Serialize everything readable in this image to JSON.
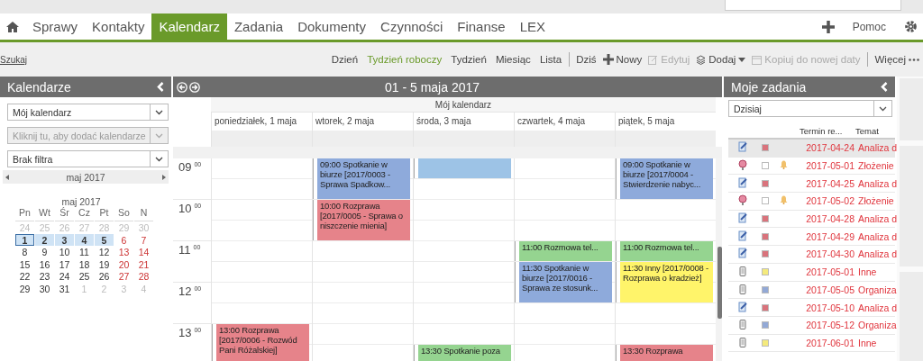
{
  "nav": {
    "tabs": [
      {
        "label": "Sprawy",
        "selected": false
      },
      {
        "label": "Kontakty",
        "selected": false
      },
      {
        "label": "Kalendarz",
        "selected": true
      },
      {
        "label": "Zadania",
        "selected": false
      },
      {
        "label": "Dokumenty",
        "selected": false
      },
      {
        "label": "Czynności",
        "selected": false
      },
      {
        "label": "Finanse",
        "selected": false
      },
      {
        "label": "LEX",
        "selected": false
      }
    ],
    "help": "Pomoc"
  },
  "toolbar": {
    "search_link": "Szukaj",
    "views": [
      {
        "label": "Dzień",
        "selected": false
      },
      {
        "label": "Tydzień roboczy",
        "selected": true
      },
      {
        "label": "Tydzień",
        "selected": false
      },
      {
        "label": "Miesiąc",
        "selected": false
      },
      {
        "label": "Lista",
        "selected": false
      }
    ],
    "actions": [
      {
        "kind": "plain",
        "label": "Dziś",
        "disabled": false
      },
      {
        "kind": "new",
        "label": "Nowy",
        "disabled": false
      },
      {
        "kind": "edit",
        "label": "Edytuj",
        "disabled": true
      },
      {
        "kind": "add",
        "label": "Dodaj",
        "disabled": false
      },
      {
        "kind": "copy",
        "label": "Kopiuj do nowej daty",
        "disabled": true
      },
      {
        "kind": "more",
        "label": "Więcej",
        "disabled": false
      }
    ]
  },
  "left_panel": {
    "title": "Kalendarze",
    "selects": [
      {
        "value": "Mój kalendarz",
        "disabled": false
      },
      {
        "value": "Kliknij tu, aby dodać kalendarze",
        "disabled": true
      },
      {
        "value": "Brak filtra",
        "disabled": false
      }
    ],
    "month_nav": "maj 2017",
    "mini_calendar": {
      "title": "maj 2017",
      "weekdays": [
        "Pn",
        "Wt",
        "Śr",
        "Cz",
        "Pt",
        "So",
        "N"
      ],
      "weeks": [
        [
          {
            "d": "24",
            "kind": "other",
            "selected": false,
            "today": false
          },
          {
            "d": "25",
            "kind": "other",
            "selected": false,
            "today": false
          },
          {
            "d": "26",
            "kind": "other",
            "selected": false,
            "today": false
          },
          {
            "d": "27",
            "kind": "other",
            "selected": false,
            "today": false
          },
          {
            "d": "28",
            "kind": "other",
            "selected": false,
            "today": false
          },
          {
            "d": "29",
            "kind": "other",
            "selected": false,
            "today": false
          },
          {
            "d": "30",
            "kind": "other",
            "selected": false,
            "today": false
          }
        ],
        [
          {
            "d": "1",
            "kind": "weekday",
            "selected": true,
            "today": true
          },
          {
            "d": "2",
            "kind": "weekday",
            "selected": true,
            "today": false
          },
          {
            "d": "3",
            "kind": "weekday",
            "selected": true,
            "today": false
          },
          {
            "d": "4",
            "kind": "weekday",
            "selected": true,
            "today": false
          },
          {
            "d": "5",
            "kind": "weekday",
            "selected": true,
            "today": false
          },
          {
            "d": "6",
            "kind": "weekend",
            "selected": false,
            "today": false
          },
          {
            "d": "7",
            "kind": "weekend",
            "selected": false,
            "today": false
          }
        ],
        [
          {
            "d": "8",
            "kind": "weekday",
            "selected": false,
            "today": false
          },
          {
            "d": "9",
            "kind": "weekday",
            "selected": false,
            "today": false
          },
          {
            "d": "10",
            "kind": "weekday",
            "selected": false,
            "today": false
          },
          {
            "d": "11",
            "kind": "weekday",
            "selected": false,
            "today": false
          },
          {
            "d": "12",
            "kind": "weekday",
            "selected": false,
            "today": false
          },
          {
            "d": "13",
            "kind": "weekend",
            "selected": false,
            "today": false
          },
          {
            "d": "14",
            "kind": "weekend",
            "selected": false,
            "today": false
          }
        ],
        [
          {
            "d": "15",
            "kind": "weekday",
            "selected": false,
            "today": false
          },
          {
            "d": "16",
            "kind": "weekday",
            "selected": false,
            "today": false
          },
          {
            "d": "17",
            "kind": "weekday",
            "selected": false,
            "today": false
          },
          {
            "d": "18",
            "kind": "weekday",
            "selected": false,
            "today": false
          },
          {
            "d": "19",
            "kind": "weekday",
            "selected": false,
            "today": false
          },
          {
            "d": "20",
            "kind": "weekend",
            "selected": false,
            "today": false
          },
          {
            "d": "21",
            "kind": "weekend",
            "selected": false,
            "today": false
          }
        ],
        [
          {
            "d": "22",
            "kind": "weekday",
            "selected": false,
            "today": false
          },
          {
            "d": "23",
            "kind": "weekday",
            "selected": false,
            "today": false
          },
          {
            "d": "24",
            "kind": "weekday",
            "selected": false,
            "today": false
          },
          {
            "d": "25",
            "kind": "weekday",
            "selected": false,
            "today": false
          },
          {
            "d": "26",
            "kind": "weekday",
            "selected": false,
            "today": false
          },
          {
            "d": "27",
            "kind": "weekend",
            "selected": false,
            "today": false
          },
          {
            "d": "28",
            "kind": "weekend",
            "selected": false,
            "today": false
          }
        ],
        [
          {
            "d": "29",
            "kind": "weekday",
            "selected": false,
            "today": false
          },
          {
            "d": "30",
            "kind": "weekday",
            "selected": false,
            "today": false
          },
          {
            "d": "31",
            "kind": "weekday",
            "selected": false,
            "today": false
          },
          {
            "d": "1",
            "kind": "other",
            "selected": false,
            "today": false
          },
          {
            "d": "2",
            "kind": "other",
            "selected": false,
            "today": false
          },
          {
            "d": "3",
            "kind": "other",
            "selected": false,
            "today": false
          },
          {
            "d": "4",
            "kind": "other",
            "selected": false,
            "today": false
          }
        ]
      ]
    }
  },
  "calendar": {
    "title": "01 - 5 maja 2017",
    "owner": "Mój kalendarz",
    "hours": [
      {
        "hour": "09",
        "minutes": "00"
      },
      {
        "hour": "10",
        "minutes": "00"
      },
      {
        "hour": "11",
        "minutes": "00"
      },
      {
        "hour": "12",
        "minutes": "00"
      },
      {
        "hour": "13",
        "minutes": "00"
      }
    ],
    "days": [
      {
        "label": "poniedziałek, 1 maja",
        "events": [
          {
            "time": "13:00",
            "kind": "long",
            "color": "#e6838a",
            "title": "Rozprawa [2017/0006 - Rozwód Pani Różalskiej]"
          }
        ]
      },
      {
        "label": "wtorek, 2 maja",
        "events": [
          {
            "time": "09:00",
            "kind": "hour",
            "color": "#8eaadb",
            "title": "Spotkanie w biurze [2017/0003 - Sprawa Spadkow..."
          },
          {
            "time": "10:00",
            "kind": "hour",
            "color": "#e6838a",
            "title": "Rozprawa [2017/0005 - Sprawa o niszczenie mienia]"
          }
        ]
      },
      {
        "label": "środa, 3 maja",
        "events": [
          {
            "kind": "half",
            "color": "#9dc3e6"
          },
          {
            "time": "13:30",
            "kind": "hour",
            "color": "#95d490",
            "title": "Spotkanie poza"
          }
        ]
      },
      {
        "label": "czwartek, 4 maja",
        "events": [
          {
            "time": "11:00",
            "kind": "half",
            "color": "#95d490",
            "title": "Rozmowa tel..."
          },
          {
            "time": "11:30",
            "kind": "hour",
            "color": "#8eaadb",
            "title": "Spotkanie w biurze [2017/0016 - Sprawa ze stosunk..."
          }
        ]
      },
      {
        "label": "piątek, 5 maja",
        "events": [
          {
            "time": "09:00",
            "kind": "hour",
            "color": "#8eaadb",
            "title": "Spotkanie w biurze [2017/0004 - Stwierdzenie nabyc..."
          },
          {
            "time": "11:00",
            "kind": "half",
            "color": "#95d490",
            "title": "Rozmowa tel..."
          },
          {
            "time": "11:30",
            "kind": "hour",
            "color": "#fff46a",
            "title": "Inny [2017/0008 - Rozprawa o kradzież]"
          },
          {
            "time": "13:30",
            "kind": "hour",
            "color": "#e6838a",
            "title": "Rozprawa"
          }
        ]
      }
    ]
  },
  "tasks": {
    "title": "Moje zadania",
    "filter": "Dzisiaj",
    "columns": [
      "Termin re...",
      "Temat"
    ],
    "rows": [
      {
        "kind": "note",
        "color": "#d9737c",
        "bell": false,
        "date": "2017-04-24",
        "topic": "Analiza d",
        "selected": true
      },
      {
        "kind": "alarm",
        "color": "#ffffff",
        "bell": true,
        "date": "2017-05-01",
        "topic": "Złożenie",
        "selected": false
      },
      {
        "kind": "note",
        "color": "#d9737c",
        "bell": false,
        "date": "2017-04-25",
        "topic": "Analiza d",
        "selected": false
      },
      {
        "kind": "alarm",
        "color": "#ffffff",
        "bell": true,
        "date": "2017-05-02",
        "topic": "Złożenie",
        "selected": false
      },
      {
        "kind": "note",
        "color": "#d9737c",
        "bell": false,
        "date": "2017-04-28",
        "topic": "Analiza d",
        "selected": false
      },
      {
        "kind": "note",
        "color": "#d9737c",
        "bell": false,
        "date": "2017-04-29",
        "topic": "Analiza d",
        "selected": false
      },
      {
        "kind": "note",
        "color": "#d9737c",
        "bell": false,
        "date": "2017-04-30",
        "topic": "Analiza d",
        "selected": false
      },
      {
        "kind": "clip",
        "color": "#f4ea7c",
        "bell": false,
        "date": "2017-05-01",
        "topic": "Inne",
        "selected": false
      },
      {
        "kind": "clip",
        "color": "#93a9d6",
        "bell": false,
        "date": "2017-05-05",
        "topic": "Organiza",
        "selected": false
      },
      {
        "kind": "note",
        "color": "#d9737c",
        "bell": false,
        "date": "2017-05-10",
        "topic": "Analiza d",
        "selected": false
      },
      {
        "kind": "clip",
        "color": "#93a9d6",
        "bell": false,
        "date": "2017-05-12",
        "topic": "Organiza",
        "selected": false
      },
      {
        "kind": "clip",
        "color": "#f4ea7c",
        "bell": false,
        "date": "2017-06-01",
        "topic": "Inne",
        "selected": false
      }
    ]
  }
}
